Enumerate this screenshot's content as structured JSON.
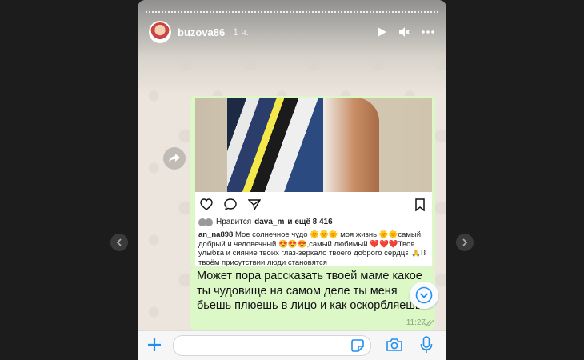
{
  "story": {
    "username": "buzova86",
    "time": "1 ч."
  },
  "post": {
    "likes_label": "Нравится",
    "likes_user": "dava_m",
    "likes_rest": "и ещё 8 416",
    "caption_user": "an_na898",
    "caption_text": "Мое солнечное чудо 🌞🌞🌞 моя жизнь 🌞🌞самый добрый и человечный 😍😍😍,самый любимый ❤️❤️❤️Твоя улыбка и сияние твоих глаз-зеркало твоего доброго сердца 🙏В твоём присутствии люди становятся"
  },
  "message": {
    "text": "Может пора рассказать твоей маме какое ты чудовище на самом деле ты меня бьешь плюешь в лицо и как оскорбляешь",
    "time": "11:27"
  },
  "colors": {
    "bubble": "#dcf8c6",
    "accent": "#1f8ff0"
  }
}
